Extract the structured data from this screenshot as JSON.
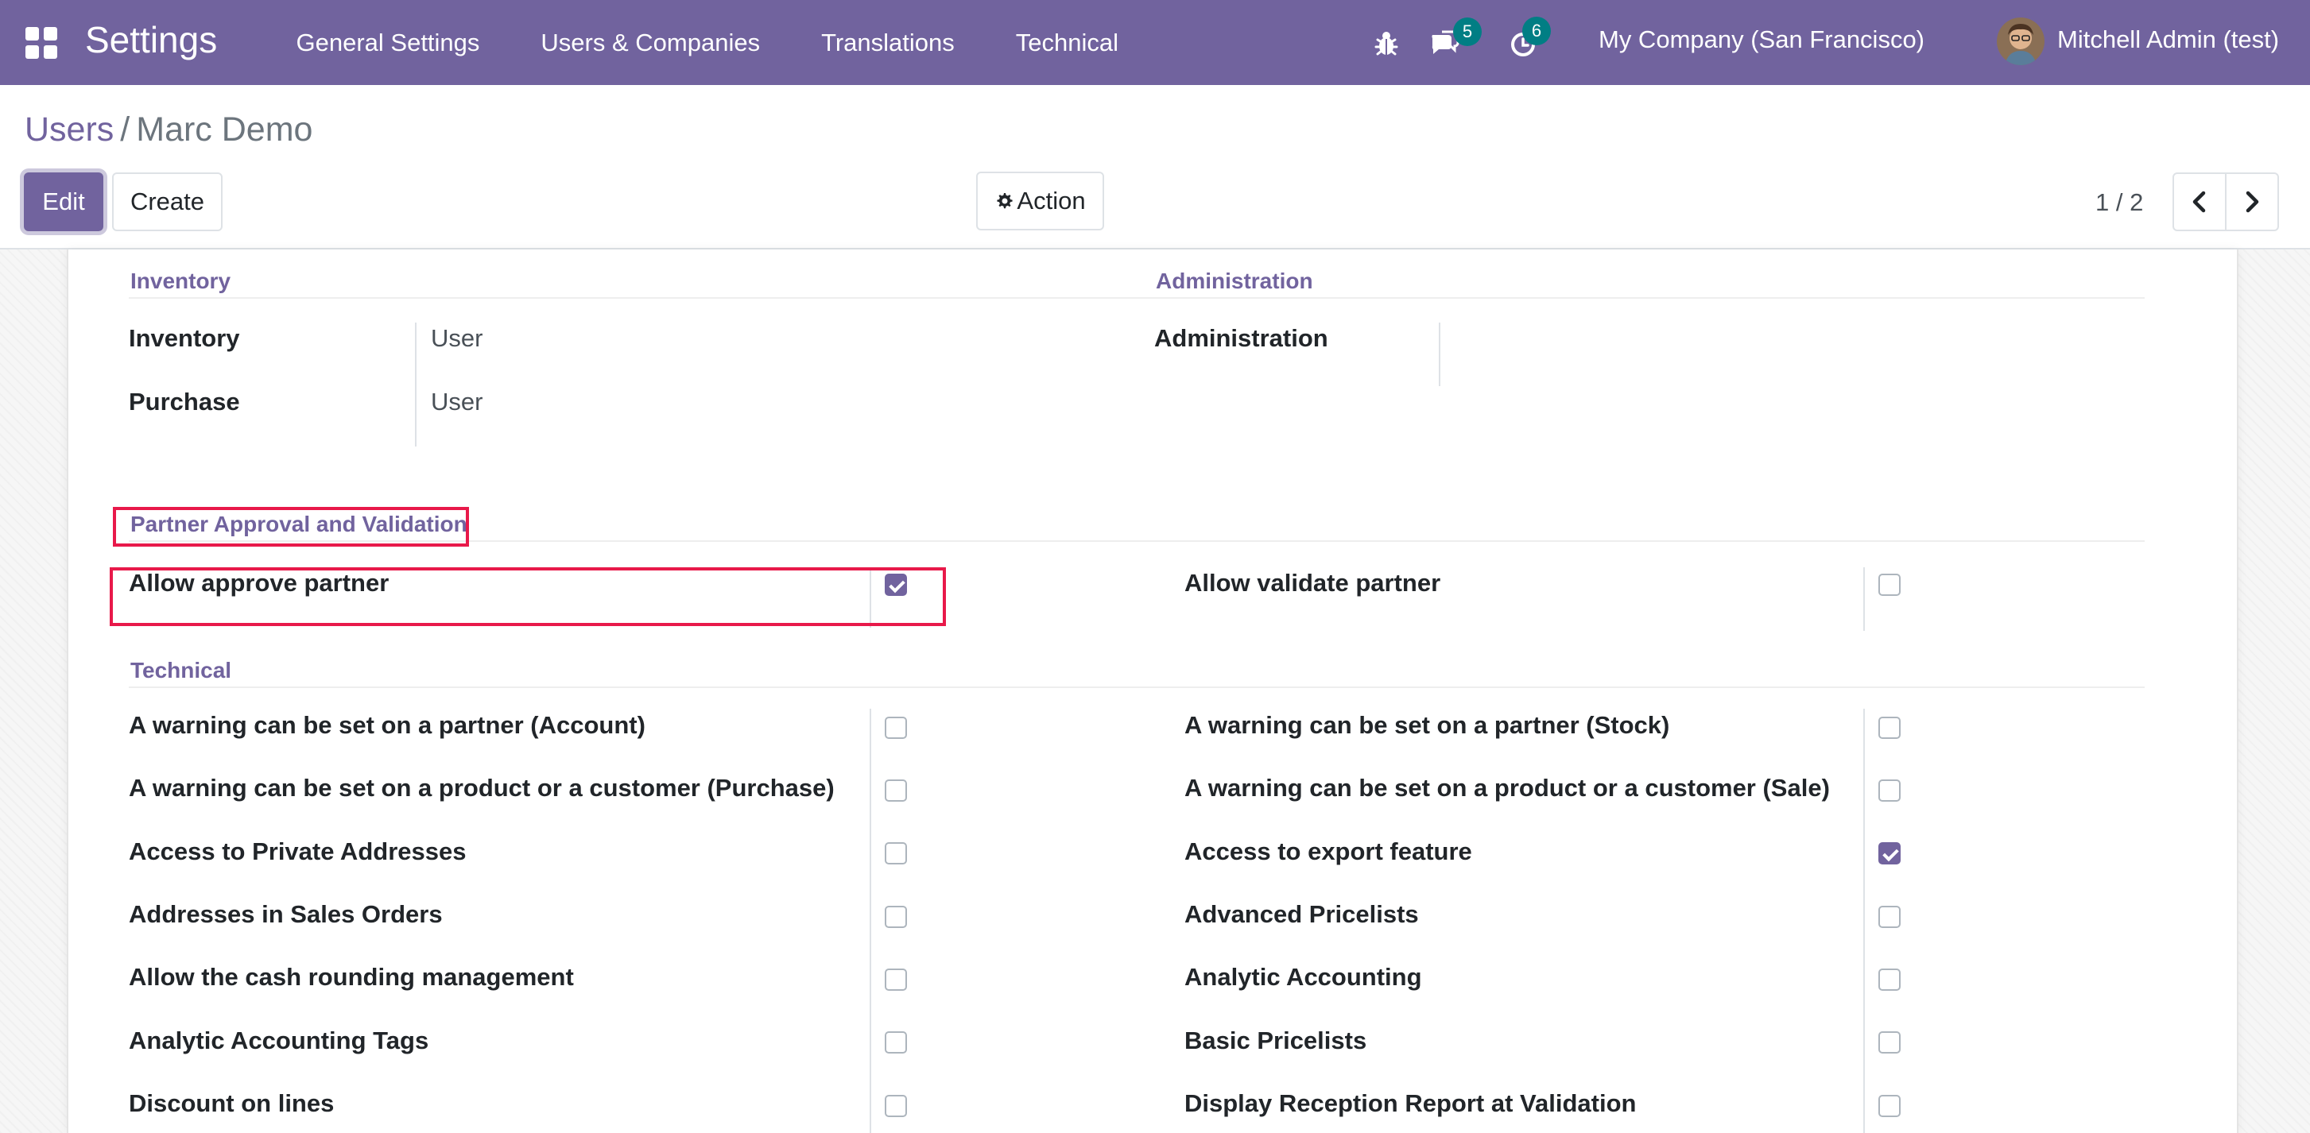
{
  "navbar": {
    "app_title": "Settings",
    "menu": [
      "General Settings",
      "Users & Companies",
      "Translations",
      "Technical"
    ],
    "messages_count": "5",
    "activities_count": "6",
    "company": "My Company (San Francisco)",
    "user": "Mitchell Admin (test)"
  },
  "breadcrumb": {
    "parent": "Users",
    "separator": "/",
    "current": "Marc Demo"
  },
  "toolbar": {
    "edit_label": "Edit",
    "create_label": "Create",
    "action_label": "Action"
  },
  "pager": {
    "value": "1 / 2"
  },
  "sections": {
    "inventory": {
      "title": "Inventory",
      "fields": [
        {
          "label": "Inventory",
          "value": "User"
        },
        {
          "label": "Purchase",
          "value": "User"
        }
      ]
    },
    "administration": {
      "title": "Administration",
      "fields": [
        {
          "label": "Administration",
          "value": ""
        }
      ]
    },
    "partner_approval": {
      "title": "Partner Approval and Validation",
      "left": [
        {
          "label": "Allow approve partner",
          "checked": true
        }
      ],
      "right": [
        {
          "label": "Allow validate partner",
          "checked": false
        }
      ]
    },
    "technical": {
      "title": "Technical",
      "left": [
        {
          "label": "A warning can be set on a partner (Account)",
          "checked": false
        },
        {
          "label": "A warning can be set on a product or a customer (Purchase)",
          "checked": false
        },
        {
          "label": "Access to Private Addresses",
          "checked": false
        },
        {
          "label": "Addresses in Sales Orders",
          "checked": false
        },
        {
          "label": "Allow the cash rounding management",
          "checked": false
        },
        {
          "label": "Analytic Accounting Tags",
          "checked": false
        },
        {
          "label": "Discount on lines",
          "checked": false
        }
      ],
      "right": [
        {
          "label": "A warning can be set on a partner (Stock)",
          "checked": false
        },
        {
          "label": "A warning can be set on a product or a customer (Sale)",
          "checked": false
        },
        {
          "label": "Access to export feature",
          "checked": true
        },
        {
          "label": "Advanced Pricelists",
          "checked": false
        },
        {
          "label": "Analytic Accounting",
          "checked": false
        },
        {
          "label": "Basic Pricelists",
          "checked": false
        },
        {
          "label": "Display Reception Report at Validation",
          "checked": false
        }
      ]
    }
  },
  "colors": {
    "brand": "#71639e",
    "badge": "#017e84",
    "highlight": "#e8194a"
  }
}
